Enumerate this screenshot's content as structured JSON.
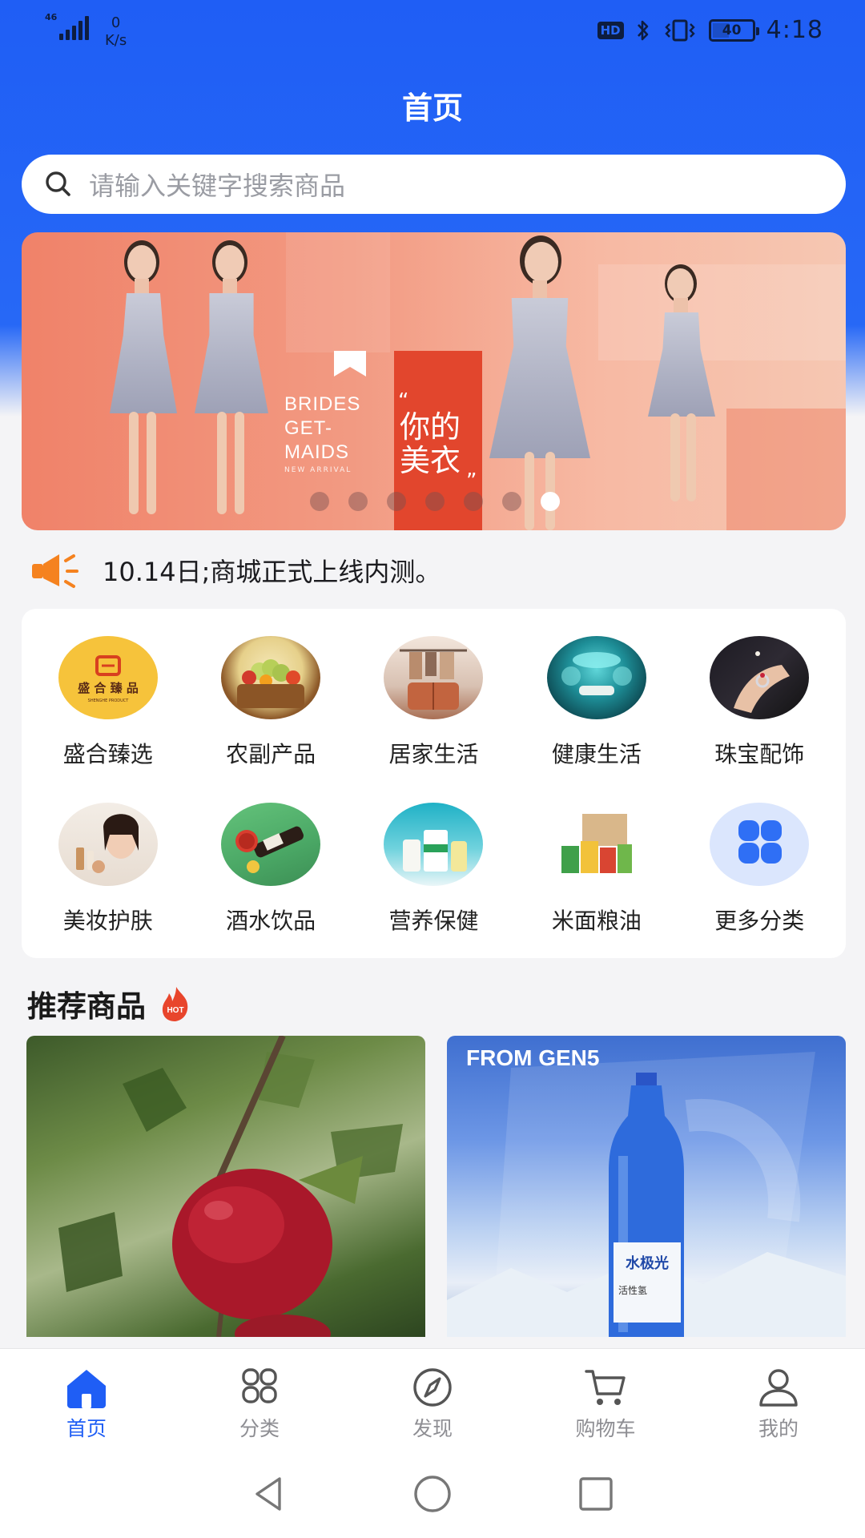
{
  "status_bar": {
    "network": "46",
    "speed_value": "0",
    "speed_unit": "K/s",
    "hd": "HD",
    "battery": "40",
    "time": "4:18"
  },
  "header": {
    "title": "首页"
  },
  "search": {
    "placeholder": "请输入关键字搜索商品",
    "icon": "search-icon"
  },
  "banner": {
    "en_lines": [
      "BRIDES",
      "GET-",
      "MAIDS"
    ],
    "sub": "NEW ARRIVAL",
    "cn_lines": [
      "你的",
      "美衣"
    ],
    "quote_open": "“",
    "quote_close": "”",
    "slide_count": 7,
    "active_slide": 7
  },
  "notice": {
    "icon": "megaphone-icon",
    "text": "10.14日;商城正式上线内测。"
  },
  "categories": [
    {
      "label": "盛合臻选",
      "icon": "shenghe-logo-icon",
      "logo_text": "盛合臻品",
      "logo_sub": "SHENGHE PRODUCT"
    },
    {
      "label": "农副产品",
      "icon": "fruit-basket-icon"
    },
    {
      "label": "居家生活",
      "icon": "luggage-icon"
    },
    {
      "label": "健康生活",
      "icon": "spa-room-icon"
    },
    {
      "label": "珠宝配饰",
      "icon": "ring-icon"
    },
    {
      "label": "美妆护肤",
      "icon": "cosmetics-icon"
    },
    {
      "label": "酒水饮品",
      "icon": "drink-bottle-icon"
    },
    {
      "label": "营养保健",
      "icon": "supplement-icon"
    },
    {
      "label": "米面粮油",
      "icon": "grocery-box-icon"
    },
    {
      "label": "更多分类",
      "icon": "more-categories-icon"
    }
  ],
  "recommend": {
    "title": "推荐商品",
    "badge": "HOT"
  },
  "products": [
    {
      "name": "apple",
      "icon": "apple-photo"
    },
    {
      "name": "water",
      "tag": "FROM GEN5",
      "label_cn": "水极光",
      "label_sub": "活性氢"
    }
  ],
  "tabs": [
    {
      "label": "首页",
      "icon": "home-icon",
      "active": true
    },
    {
      "label": "分类",
      "icon": "category-icon",
      "active": false
    },
    {
      "label": "发现",
      "icon": "compass-icon",
      "active": false
    },
    {
      "label": "购物车",
      "icon": "cart-icon",
      "active": false
    },
    {
      "label": "我的",
      "icon": "user-icon",
      "active": false
    }
  ],
  "colors": {
    "primary": "#1f5ef5",
    "banner": "#f08269",
    "notice": "#f5821f",
    "hot": "#e8452c"
  }
}
